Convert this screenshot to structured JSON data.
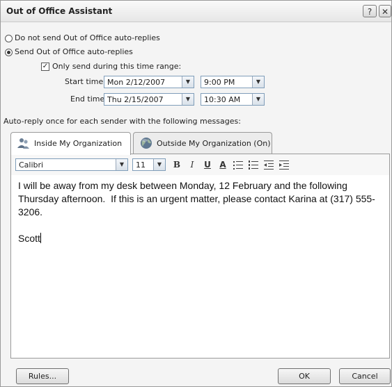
{
  "window": {
    "title": "Out of Office Assistant",
    "help_label": "?",
    "close_label": "✕"
  },
  "reply_mode": {
    "no_send_label": "Do not send Out of Office auto-replies",
    "send_label": "Send Out of Office auto-replies",
    "selected": "send"
  },
  "time_range": {
    "checkbox_label": "Only send during this time range:",
    "checked": true,
    "start_label": "Start time:",
    "start_date": "Mon 2/12/2007",
    "start_time": "9:00 PM",
    "end_label": "End time:",
    "end_date": "Thu 2/15/2007",
    "end_time": "10:30 AM"
  },
  "auto_reply_label": "Auto-reply once for each sender with the following messages:",
  "tabs": [
    {
      "label": "Inside My Organization",
      "active": true,
      "icon": "people-icon"
    },
    {
      "label": "Outside My Organization (On)",
      "active": false,
      "icon": "globe-icon"
    }
  ],
  "format": {
    "font": "Calibri",
    "size": "11",
    "bold": "B",
    "italic": "I",
    "underline": "U",
    "font_color": "A"
  },
  "message": {
    "paragraph1": "I will be away from my desk between Monday, 12 February and the following Thursday afternoon.  If this is an urgent matter, please contact Karina at (317) 555-3206.",
    "signature": "Scott"
  },
  "buttons": {
    "rules": "Rules...",
    "ok": "OK",
    "cancel": "Cancel"
  }
}
